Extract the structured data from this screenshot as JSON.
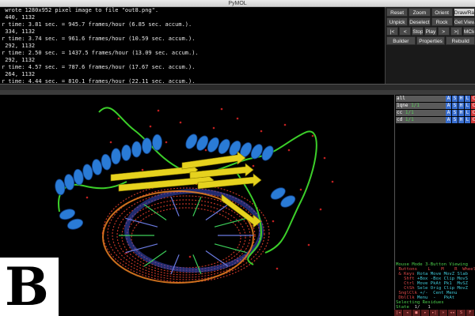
{
  "window": {
    "title": "PyMOL"
  },
  "console": {
    "lines": [
      " wrote 1280x952 pixel image to file \"out8.png\".",
      " 440, 1132",
      "r time: 3.81 sec. = 945.7 frames/hour (6.85 sec. accum.).",
      " 334, 1132",
      "r time: 3.74 sec. = 961.6 frames/hour (10.59 sec. accum.).",
      " 292, 1132",
      "r time: 2.50 sec. = 1437.5 frames/hour (13.09 sec. accum.).",
      " 292, 1132",
      "r time: 4.57 sec. = 787.6 frames/hour (17.67 sec. accum.).",
      " 264, 1132",
      "r time: 4.44 sec. = 810.1 frames/hour (22.11 sec. accum.)."
    ]
  },
  "buttons": {
    "row1": [
      "Reset",
      "Zoom",
      "Orient",
      "Draw/Ray"
    ],
    "row2": [
      "Unpick",
      "Deselect",
      "Rock",
      "Get View"
    ],
    "row3": [
      "|<",
      "<",
      "Stop",
      "Play",
      ">",
      ">|",
      "MClear"
    ],
    "row4": [
      "Builder",
      "Properties",
      "Rebuild"
    ],
    "active": "Draw/Ray"
  },
  "objects": [
    {
      "name": "all",
      "state": ""
    },
    {
      "name": "1qne",
      "state": "1/1"
    },
    {
      "name": "cc",
      "state": "1/1"
    },
    {
      "name": "cd",
      "state": "1/1"
    }
  ],
  "object_actions": [
    "A",
    "S",
    "H",
    "L",
    "C"
  ],
  "action_colors": [
    "#3a6fd0",
    "#3a6fd0",
    "#3a6fd0",
    "#3a6fd0",
    "#d03a3a"
  ],
  "mouse_panel": {
    "mode_label": "Mouse Mode",
    "mode_value": "3-Button Viewing",
    "header": " Buttons    L    M    R  Wheel",
    "rows": [
      {
        "key": " & Keys",
        "vals": "Rota Move MovZ Slab"
      },
      {
        "key": "   Shft",
        "vals": "+Box -Box Clip MovS"
      },
      {
        "key": "   Ctrl",
        "vals": "Move PkAt Pk1  MvSZ"
      },
      {
        "key": "   CtSh",
        "vals": "Sele Orig Clip MovZ"
      },
      {
        "key": " SnglClk",
        "vals": "+/-  Cent Menu"
      },
      {
        "key": " DblClk",
        "vals": "Menu  -   PkAt"
      }
    ],
    "selecting": "Selecting Residues",
    "state_label": "State",
    "state_value": "  1/   1"
  },
  "playbar": [
    "|◂",
    "◂",
    "■",
    "▸",
    "▸|",
    "»",
    "◂◂",
    "S",
    "F"
  ],
  "logo": {
    "letter": "B"
  },
  "colors": {
    "helix": "#2a7bd6",
    "sheet": "#e6d21e",
    "loop": "#3ccf2a",
    "dna_mesh": "#d43a2a",
    "dna_blue": "#3b4fc8",
    "waters": "#c02020"
  }
}
